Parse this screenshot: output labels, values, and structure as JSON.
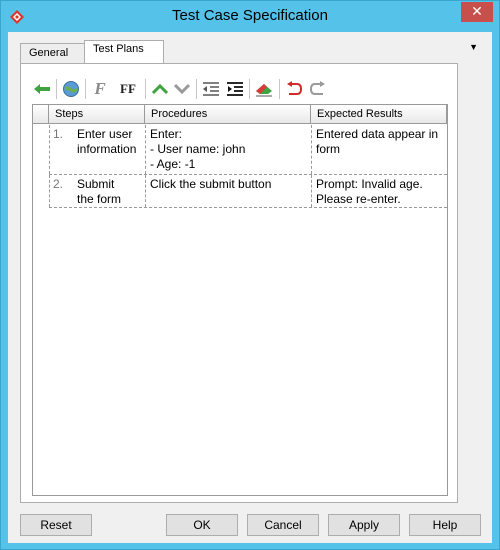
{
  "window": {
    "title": "Test Case Specification",
    "close_glyph": "✕"
  },
  "tabs": [
    {
      "label": "General",
      "active": false
    },
    {
      "label": "Test Plans",
      "active": true
    }
  ],
  "tab_menu_glyph": "▼",
  "toolbar": {
    "icons": [
      "back-arrow-icon",
      "globe-icon",
      "italic-font-icon",
      "bold-font-icon",
      "move-up-icon",
      "move-down-icon",
      "outdent-icon",
      "indent-icon",
      "clear-format-icon",
      "undo-icon",
      "redo-icon"
    ],
    "italic_glyph": "F",
    "bold_glyph": "FF"
  },
  "grid": {
    "columns": [
      "Steps",
      "Procedures",
      "Expected Results"
    ],
    "rows": [
      {
        "num": "1.",
        "steps": [
          "Enter user",
          "information"
        ],
        "procedures": [
          "Enter:",
          "- User name: john",
          "- Age: -1"
        ],
        "expected": [
          "Entered data appear in",
          "form"
        ]
      },
      {
        "num": "2.",
        "steps": [
          "Submit",
          "the form"
        ],
        "procedures": [
          "Click the submit button"
        ],
        "expected": [
          "Prompt: Invalid age.",
          "Please re-enter."
        ]
      }
    ]
  },
  "buttons": {
    "reset": "Reset",
    "ok": "OK",
    "cancel": "Cancel",
    "apply": "Apply",
    "help": "Help"
  },
  "colors": {
    "titlebar": "#55c2ea",
    "close": "#c7504c",
    "panel": "#f0f0f0"
  }
}
